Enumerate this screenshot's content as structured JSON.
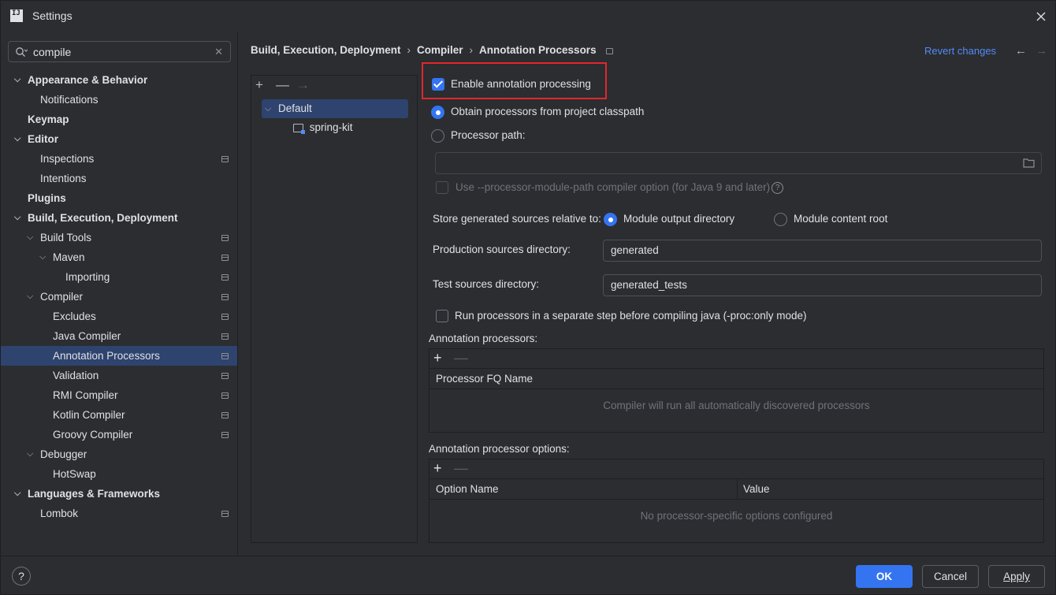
{
  "window": {
    "title": "Settings"
  },
  "search": {
    "query": "compile"
  },
  "sidebar": {
    "items": [
      {
        "label": "Appearance & Behavior",
        "expanded": true
      },
      {
        "label": "Notifications"
      },
      {
        "label": "Keymap"
      },
      {
        "label": "Editor",
        "expanded": true
      },
      {
        "label": "Inspections"
      },
      {
        "label": "Intentions"
      },
      {
        "label": "Plugins"
      },
      {
        "label": "Build, Execution, Deployment",
        "expanded": true
      },
      {
        "label": "Build Tools",
        "expanded": true
      },
      {
        "label": "Maven",
        "expanded": true
      },
      {
        "label": "Importing"
      },
      {
        "label": "Compiler",
        "expanded": true
      },
      {
        "label": "Excludes"
      },
      {
        "label": "Java Compiler"
      },
      {
        "label": "Annotation Processors",
        "selected": true
      },
      {
        "label": "Validation"
      },
      {
        "label": "RMI Compiler"
      },
      {
        "label": "Kotlin Compiler"
      },
      {
        "label": "Groovy Compiler"
      },
      {
        "label": "Debugger",
        "expanded": true
      },
      {
        "label": "HotSwap"
      },
      {
        "label": "Languages & Frameworks",
        "expanded": true
      },
      {
        "label": "Lombok"
      }
    ]
  },
  "breadcrumb": {
    "part1": "Build, Execution, Deployment",
    "part2": "Compiler",
    "part3": "Annotation Processors",
    "sep": "›"
  },
  "header": {
    "revert": "Revert changes"
  },
  "profiles": {
    "default": "Default",
    "module": "spring-kit"
  },
  "options": {
    "enable": "Enable annotation processing",
    "enable_checked": true,
    "obtain_classpath": "Obtain processors from project classpath",
    "processor_path": "Processor path:",
    "processor_path_value": "",
    "module_path": "Use --processor-module-path compiler option (for Java 9 and later)",
    "store_label": "Store generated sources relative to:",
    "module_output": "Module output directory",
    "module_content": "Module content root",
    "prod_label": "Production sources directory:",
    "prod_value": "generated",
    "test_label": "Test sources directory:",
    "test_value": "generated_tests",
    "separate_step": "Run processors in a separate step before compiling java (-proc:only mode)"
  },
  "processors": {
    "title": "Annotation processors:",
    "col_name": "Processor FQ Name",
    "empty": "Compiler will run all automatically discovered processors"
  },
  "processor_options": {
    "title": "Annotation processor options:",
    "col_name": "Option Name",
    "col_value": "Value",
    "empty": "No processor-specific options configured"
  },
  "footer": {
    "help": "?",
    "ok": "OK",
    "cancel": "Cancel",
    "apply": "Apply"
  },
  "colors": {
    "accent": "#3574f0",
    "highlight_box": "#e2262e",
    "link": "#548af7",
    "selection": "#2e436e"
  }
}
